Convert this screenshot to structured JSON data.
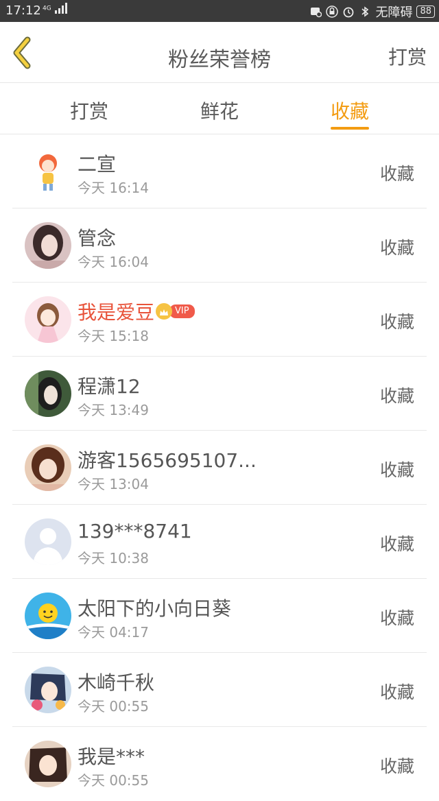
{
  "status": {
    "time": "17:12",
    "network": "4G",
    "accessibility": "无障碍",
    "battery": "88"
  },
  "header": {
    "title": "粉丝荣誉榜",
    "right_action": "打赏"
  },
  "tabs": [
    {
      "label": "打赏"
    },
    {
      "label": "鲜花"
    },
    {
      "label": "收藏"
    }
  ],
  "active_tab": "收藏",
  "colors": {
    "accent": "#f39c12",
    "vip_name": "#e8533a",
    "vip_badge": "#f05a4a"
  },
  "rows": [
    {
      "name": "二宣",
      "time": "今天 16:14",
      "action": "收藏",
      "avatar": "cartoon-boy-avatar"
    },
    {
      "name": "管念",
      "time": "今天 16:04",
      "action": "收藏",
      "avatar": "photo-avatar"
    },
    {
      "name": "我是爱豆",
      "time": "今天 15:18",
      "action": "收藏",
      "avatar": "anime-girl-avatar",
      "vip": "VIP"
    },
    {
      "name": "程潇12",
      "time": "今天 13:49",
      "action": "收藏",
      "avatar": "photo-avatar"
    },
    {
      "name": "游客1565695107...",
      "time": "今天 13:04",
      "action": "收藏",
      "avatar": "photo-avatar"
    },
    {
      "name": "139***8741",
      "time": "今天 10:38",
      "action": "收藏",
      "avatar": "default-person-avatar"
    },
    {
      "name": "太阳下的小向日葵",
      "time": "今天 04:17",
      "action": "收藏",
      "avatar": "sun-avatar"
    },
    {
      "name": "木崎千秋",
      "time": "今天 00:55",
      "action": "收藏",
      "avatar": "anime-avatar"
    },
    {
      "name": "我是***",
      "time": "今天 00:55",
      "action": "收藏",
      "avatar": "anime-avatar"
    }
  ]
}
